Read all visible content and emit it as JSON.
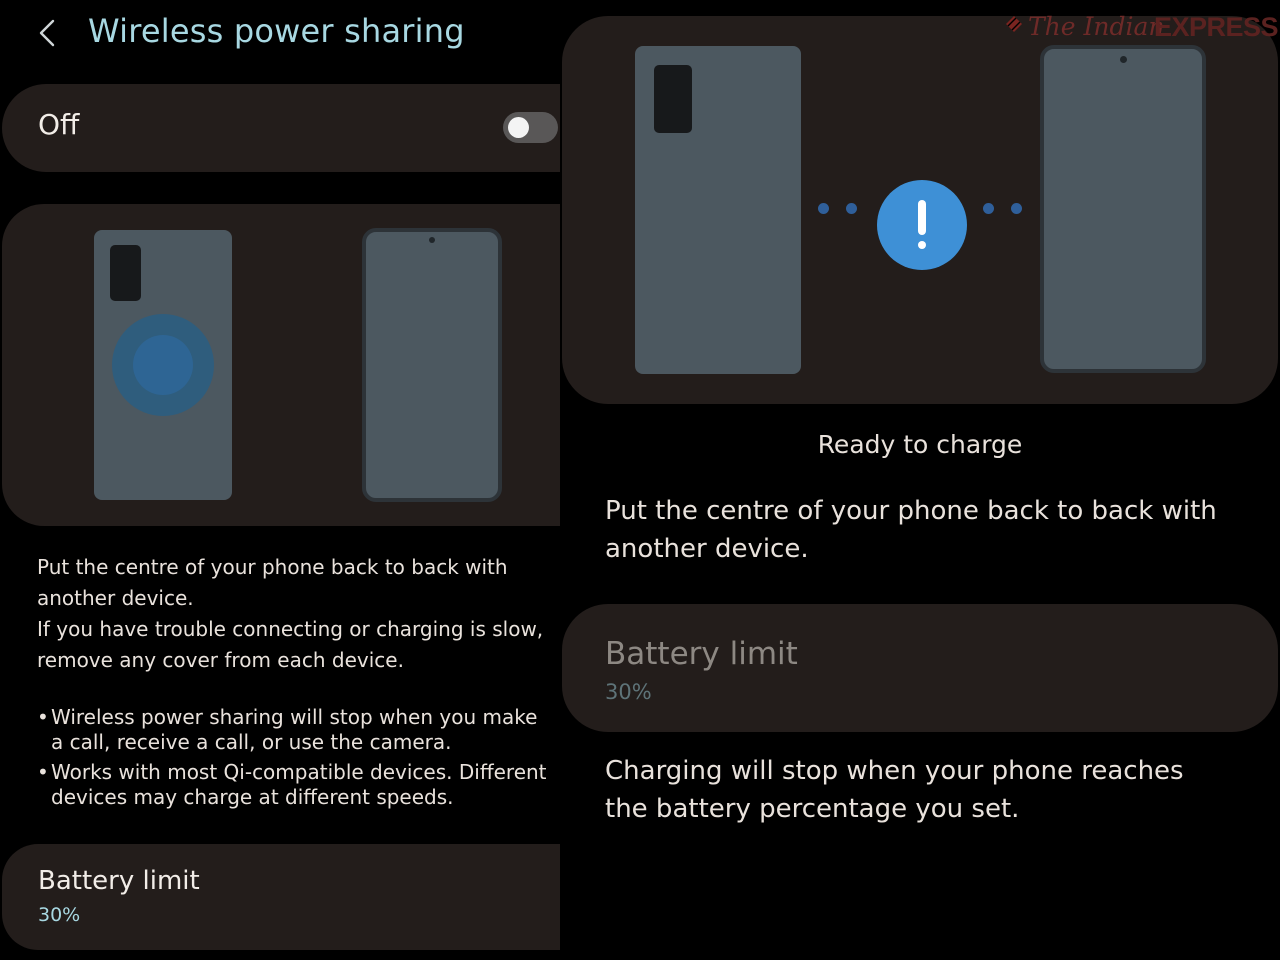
{
  "left_panel": {
    "header": {
      "title": "Wireless power sharing",
      "back_icon": "chevron-left-icon"
    },
    "master_switch": {
      "label": "Off",
      "state": "off"
    },
    "instructions": [
      "Put the centre of your phone back to back with another device.",
      "If you have trouble connecting or charging is slow, remove any cover from each device."
    ],
    "notes": [
      "Wireless power sharing will stop when you make a call, receive a call, or use the camera.",
      "Works with most Qi-compatible devices. Different devices may charge at different speeds."
    ],
    "battery_limit": {
      "title": "Battery limit",
      "value": "30%"
    }
  },
  "right_panel": {
    "watermark": {
      "the_indian": "The Indian",
      "express": "EXPRESS"
    },
    "status": "Ready to charge",
    "instruction": "Put the centre of your phone back to back with another device.",
    "battery_limit": {
      "title": "Battery limit",
      "value": "30%"
    },
    "note": "Charging will stop when your phone reaches the battery percentage you set."
  },
  "colors": {
    "background": "#000000",
    "card": "#231d1b",
    "accent": "#a8d8e2",
    "alert_blue": "#3e90d6",
    "watermark_red": "#6e2a28"
  }
}
